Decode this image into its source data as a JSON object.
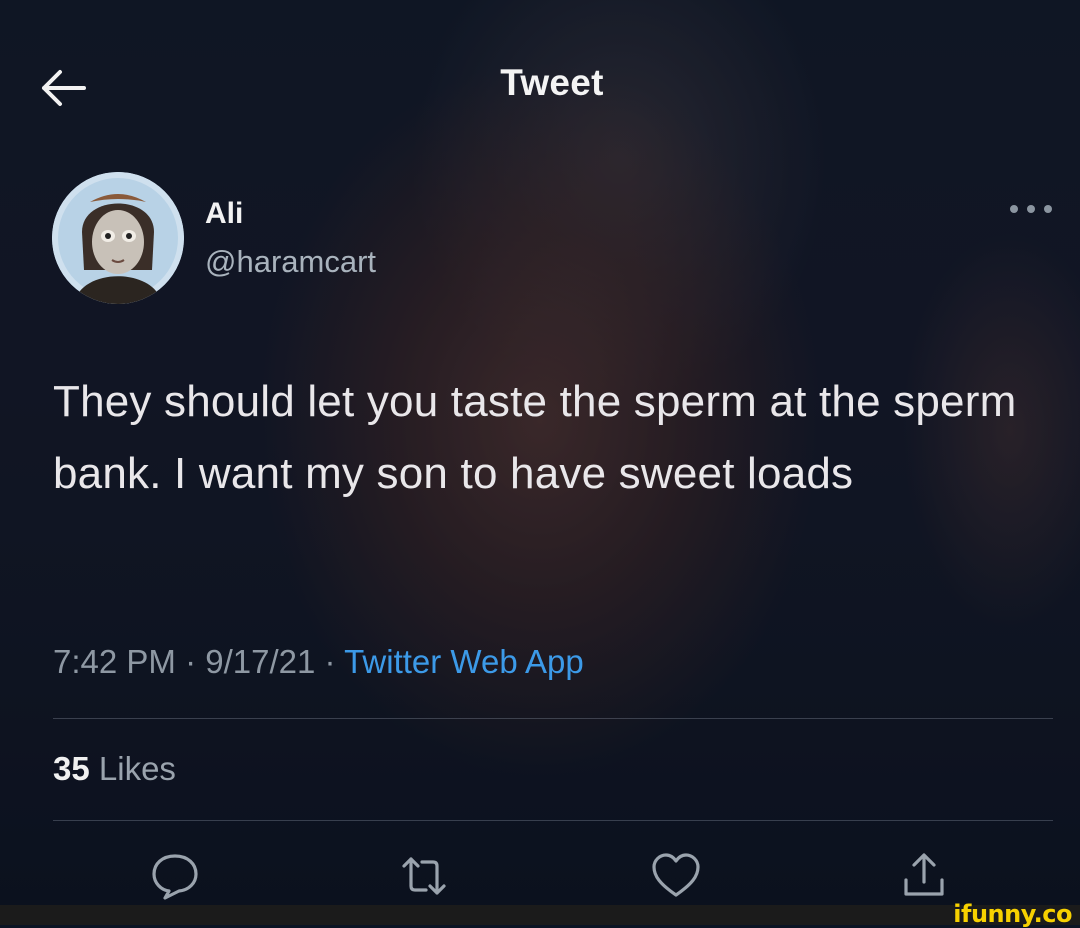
{
  "header": {
    "title": "Tweet",
    "back_icon": "arrow-left-icon"
  },
  "author": {
    "name": "Ali",
    "handle": "@haramcart",
    "avatar": "avatar-image"
  },
  "tweet": {
    "text": "They should let you taste the sperm at the sperm bank. I want my son to have sweet loads",
    "time": "7:42 PM",
    "sep1": " · ",
    "date": "9/17/21",
    "sep2": " · ",
    "source": "Twitter Web App"
  },
  "stats": {
    "likes_count": "35",
    "likes_label": "Likes"
  },
  "actions": {
    "reply": "reply-icon",
    "retweet": "retweet-icon",
    "like": "heart-icon",
    "share": "share-icon"
  },
  "colors": {
    "link": "#3c9ae8",
    "watermark": "#f7d100"
  },
  "watermark": "ifunny.co"
}
